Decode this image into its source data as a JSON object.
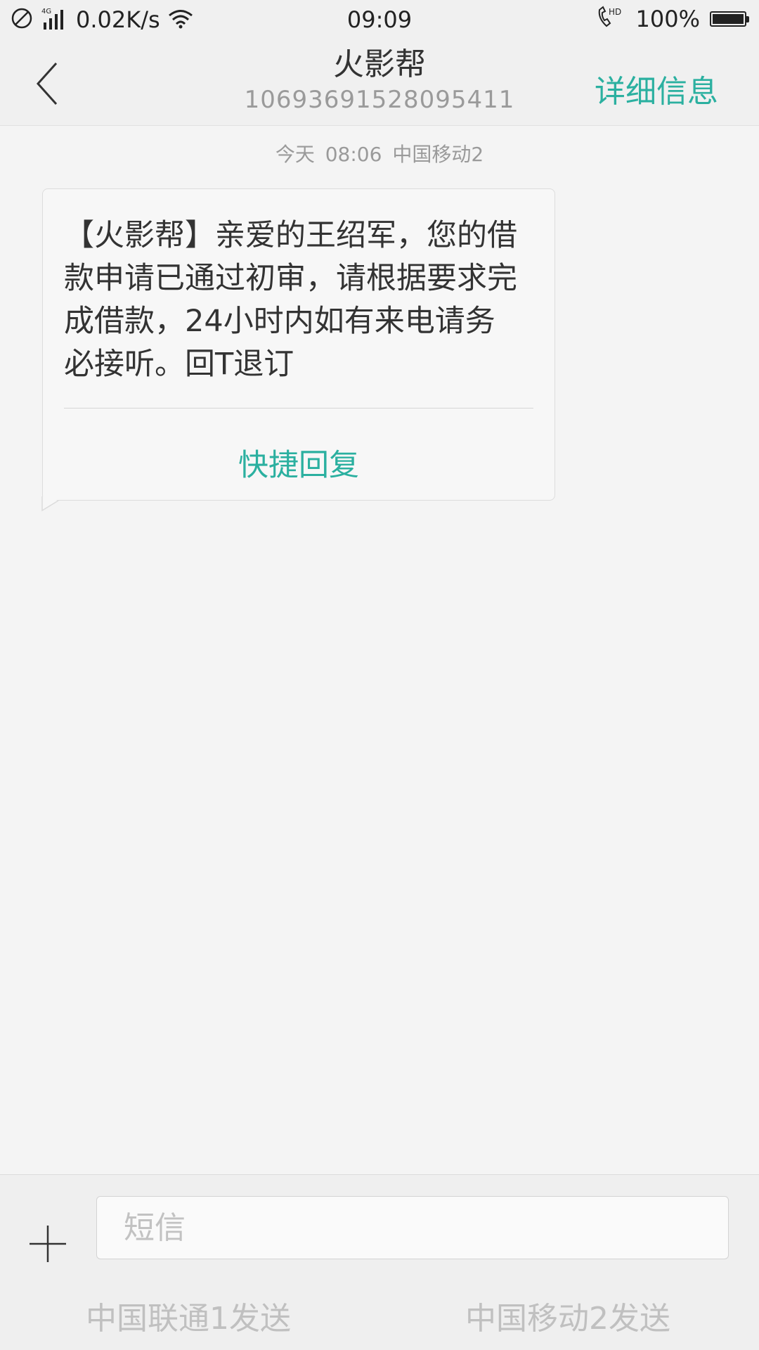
{
  "status_bar": {
    "network_speed": "0.02K/s",
    "network_type": "4G",
    "time": "09:09",
    "call_badge": "HD",
    "battery_percent": "100%",
    "battery_level": 1.0
  },
  "header": {
    "title": "火影帮",
    "subtitle": "10693691528095411",
    "details_label": "详细信息"
  },
  "conversation": {
    "timestamp": "今天  08:06  中国移动2",
    "messages": [
      {
        "text": "【火影帮】亲爱的王绍军，您的借款申请已通过初审，请根据要求完成借款，24小时内如有来电请务必接听。回T退订",
        "quick_reply_label": "快捷回复"
      }
    ]
  },
  "composer": {
    "placeholder": "短信",
    "value": "",
    "send_sim1_label": "中国联通1发送",
    "send_sim2_label": "中国移动2发送"
  },
  "colors": {
    "accent": "#2bb0a0",
    "background": "#f4f4f4",
    "header_bg": "#f0f0f0"
  }
}
